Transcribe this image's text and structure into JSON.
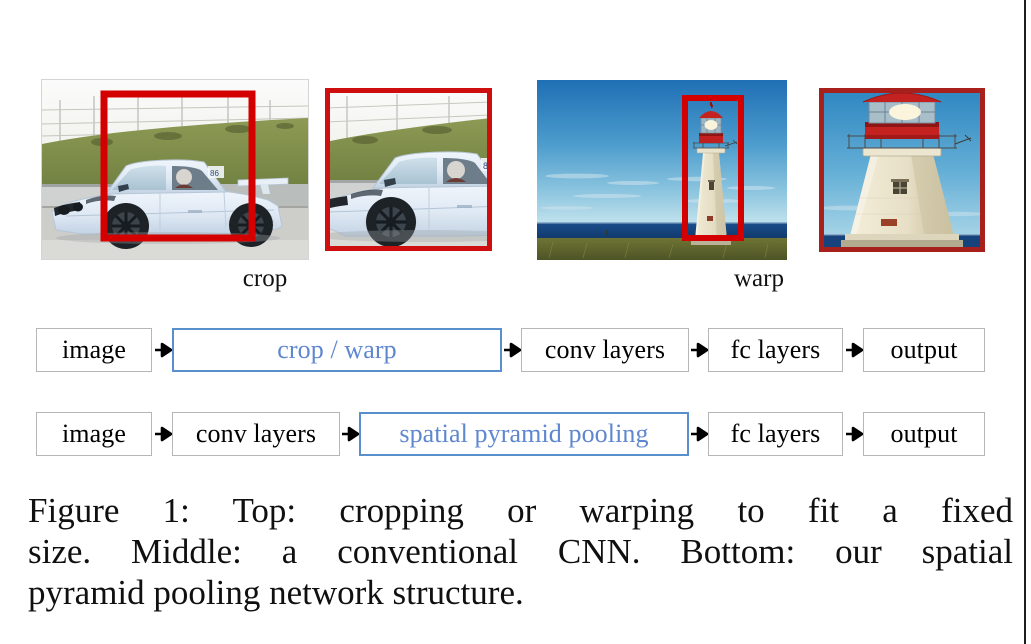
{
  "figure": {
    "photo_groups": [
      {
        "name": "crop",
        "label": "crop",
        "source_photo": "race-car-on-track",
        "cropped_photo": "race-car-cropped",
        "box_color": "#d40000"
      },
      {
        "name": "warp",
        "label": "warp",
        "source_photo": "lighthouse-by-the-sea",
        "cropped_photo": "lighthouse-warped",
        "box_color": "#cc1111"
      }
    ]
  },
  "pipelines": [
    {
      "id": "conventional-cnn",
      "stages": [
        {
          "label": "image",
          "accent": false
        },
        {
          "label": "crop / warp",
          "accent": true
        },
        {
          "label": "conv layers",
          "accent": false
        },
        {
          "label": "fc layers",
          "accent": false
        },
        {
          "label": "output",
          "accent": false
        }
      ]
    },
    {
      "id": "spp-net",
      "stages": [
        {
          "label": "image",
          "accent": false
        },
        {
          "label": "conv layers",
          "accent": false
        },
        {
          "label": "spatial pyramid pooling",
          "accent": true
        },
        {
          "label": "fc layers",
          "accent": false
        },
        {
          "label": "output",
          "accent": false
        }
      ]
    }
  ],
  "caption": {
    "line1": "Figure 1: Top: cropping or warping to fit a fixed",
    "line2": "size. Middle: a conventional CNN. Bottom: our spatial",
    "line3": "pyramid pooling network structure."
  },
  "colors": {
    "accent_border": "#5a8fce",
    "accent_text": "#5f87cf",
    "box_border": "#b6b6b6",
    "bbox_red": "#d40000",
    "text": "#101010"
  }
}
